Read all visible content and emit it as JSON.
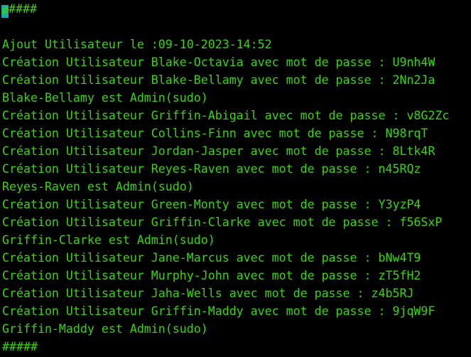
{
  "terminal": {
    "cursor_char": "#",
    "header_rest": "####",
    "blank": "",
    "date_line": "Ajout Utilisateur le :09-10-2023-14:52",
    "lines": [
      "Création Utilisateur Blake-Octavia avec mot de passe : U9nh4W",
      "Création Utilisateur Blake-Bellamy avec mot de passe : 2Nn2Ja",
      "Blake-Bellamy est Admin(sudo)",
      "Création Utilisateur Griffin-Abigail avec mot de passe : v8G2Zc",
      "Création Utilisateur Collins-Finn avec mot de passe : N98rqT",
      "Création Utilisateur Jordan-Jasper avec mot de passe : 8Ltk4R",
      "Création Utilisateur Reyes-Raven avec mot de passe : n45RQz",
      "Reyes-Raven est Admin(sudo)",
      "Création Utilisateur Green-Monty avec mot de passe : Y3yzP4",
      "Création Utilisateur Griffin-Clarke avec mot de passe : f56SxP",
      "Griffin-Clarke est Admin(sudo)",
      "Création Utilisateur Jane-Marcus avec mot de passe : bNw4T9",
      "Création Utilisateur Murphy-John avec mot de passe : zT5fH2",
      "Création Utilisateur Jaha-Wells avec mot de passe : z4b5RJ",
      "Création Utilisateur Griffin-Maddy avec mot de passe : 9jqW9F",
      "Griffin-Maddy est Admin(sudo)"
    ],
    "footer": "#####"
  },
  "colors": {
    "background": "#000000",
    "text": "#3bd20f",
    "cursor": "#17a6b3"
  }
}
